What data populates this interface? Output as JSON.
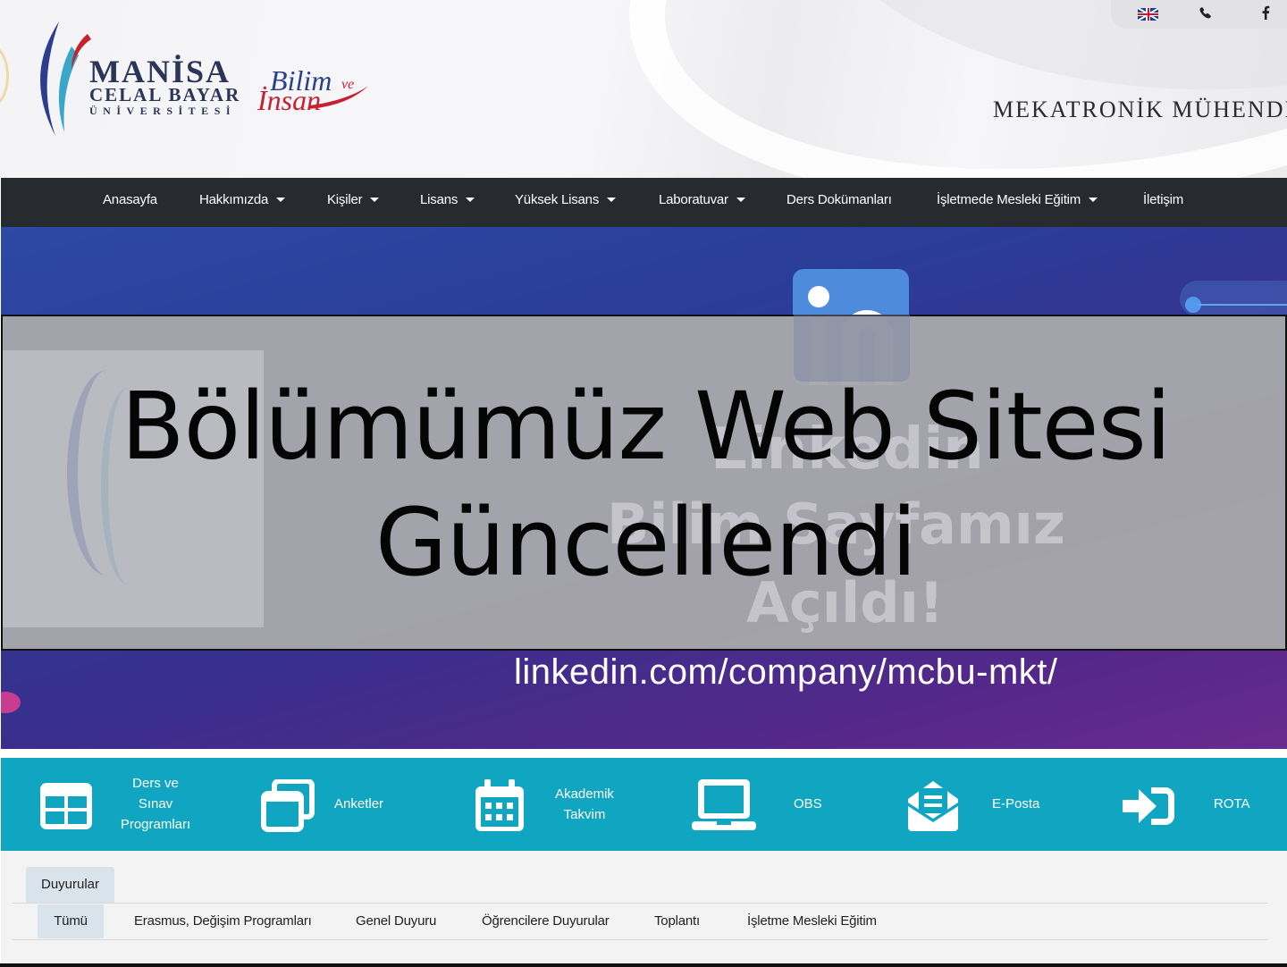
{
  "header": {
    "logo": {
      "line1": "MANİSA",
      "line2": "CELAL BAYAR",
      "line3": "ÜNİVERSİTESİ"
    },
    "slogan": {
      "bilim": "Bilim",
      "ve": "ve",
      "insan": "İnsan"
    },
    "department_title": "MEKATRONİK MÜHENDİSLİĞİ",
    "topbar_icons": [
      "uk-flag-icon",
      "phone-icon",
      "facebook-icon"
    ]
  },
  "nav": {
    "items": [
      {
        "label": "Anasayfa",
        "dropdown": false
      },
      {
        "label": "Hakkımızda",
        "dropdown": true
      },
      {
        "label": "Kişiler",
        "dropdown": true
      },
      {
        "label": "Lisans",
        "dropdown": true
      },
      {
        "label": "Yüksek Lisans",
        "dropdown": true
      },
      {
        "label": "Laboratuvar",
        "dropdown": true
      },
      {
        "label": "Ders Dokümanları",
        "dropdown": false
      },
      {
        "label": "İşletmede Mesleki Eğitim",
        "dropdown": true
      },
      {
        "label": "İletişim",
        "dropdown": false
      }
    ]
  },
  "banner": {
    "faded_line1": "Linkedin",
    "faded_line2": "Bilim Sayfamız",
    "faded_line3": "Açıldı!",
    "url_text": "linkedin.com/company/mcbu-mkt/"
  },
  "overlay": {
    "title_line1": "Bölümümüz Web Sitesi",
    "title_line2": "Güncellendi"
  },
  "quick_links": [
    {
      "icon": "table-icon",
      "label_lines": [
        "Ders ve",
        "Sınav",
        "Programları"
      ]
    },
    {
      "icon": "windows-icon",
      "label_lines": [
        "Anketler"
      ]
    },
    {
      "icon": "calendar-icon",
      "label_lines": [
        "Akademik",
        "Takvim"
      ]
    },
    {
      "icon": "laptop-icon",
      "label_lines": [
        "OBS"
      ]
    },
    {
      "icon": "envelope-icon",
      "label_lines": [
        "E-Posta"
      ]
    },
    {
      "icon": "sign-in-icon",
      "label_lines": [
        "ROTA"
      ]
    }
  ],
  "announcements": {
    "tab_label": "Duyurular",
    "categories": [
      {
        "label": "Tümü",
        "active": true
      },
      {
        "label": "Erasmus, Değişim Programları",
        "active": false
      },
      {
        "label": "Genel Duyuru",
        "active": false
      },
      {
        "label": "Öğrencilere Duyurular",
        "active": false
      },
      {
        "label": "Toplantı",
        "active": false
      },
      {
        "label": "İşletme Mesleki Eğitim",
        "active": false
      }
    ]
  },
  "colors": {
    "nav_bg": "#272b30",
    "quick_bg": "#10a5c1",
    "tab_active_bg": "#d9e3ec",
    "logo_blue": "#2a3558",
    "slogan_red": "#c8202f"
  }
}
